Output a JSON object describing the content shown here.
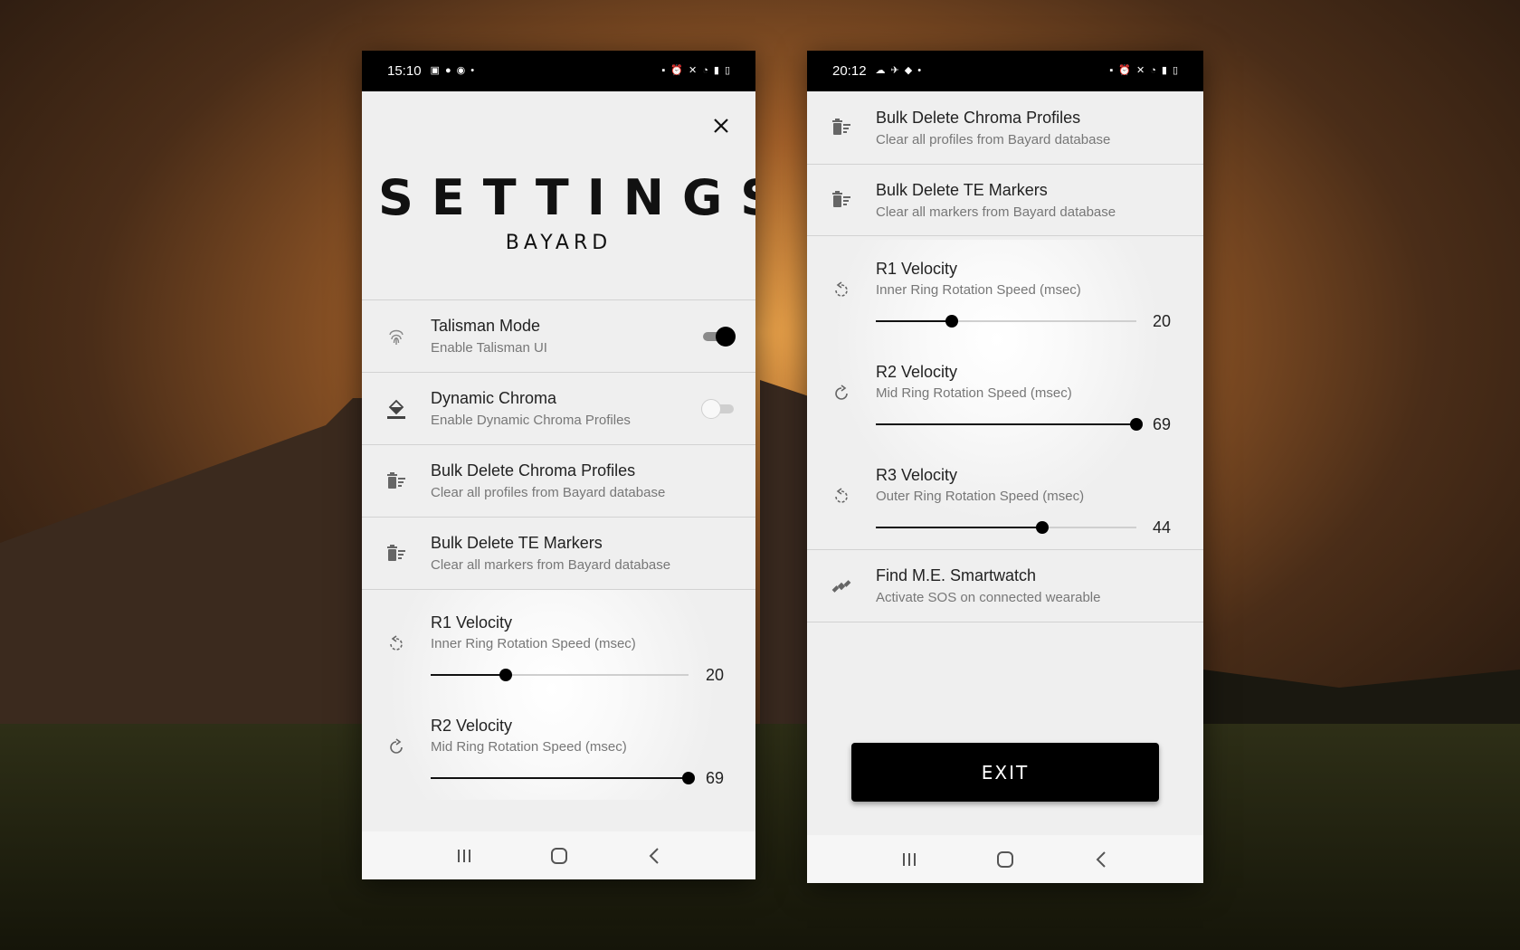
{
  "left_phone": {
    "status": {
      "time": "15:10"
    },
    "title": "SETTINGS",
    "subtitle": "BAYARD",
    "rows": [
      {
        "icon": "fingerprint-icon",
        "title": "Talisman Mode",
        "subtitle": "Enable Talisman UI",
        "toggle": true
      },
      {
        "icon": "paint-bucket-icon",
        "title": "Dynamic Chroma",
        "subtitle": "Enable Dynamic Chroma Profiles",
        "toggle": false
      },
      {
        "icon": "delete-sweep-icon",
        "title": "Bulk Delete Chroma Profiles",
        "subtitle": "Clear all profiles from Bayard database"
      },
      {
        "icon": "delete-sweep-icon",
        "title": "Bulk Delete TE Markers",
        "subtitle": "Clear all markers from Bayard database"
      }
    ],
    "sliders": [
      {
        "icon": "rotate-ccw-icon",
        "title": "R1 Velocity",
        "subtitle": "Inner Ring Rotation Speed (msec)",
        "value": "20",
        "fraction": 0.29
      },
      {
        "icon": "rotate-cw-icon",
        "title": "R2 Velocity",
        "subtitle": "Mid Ring Rotation Speed (msec)",
        "value": "69",
        "fraction": 1.0
      }
    ]
  },
  "right_phone": {
    "status": {
      "time": "20:12"
    },
    "rows": [
      {
        "icon": "delete-sweep-icon",
        "title": "Bulk Delete Chroma Profiles",
        "subtitle": "Clear all profiles from Bayard database"
      },
      {
        "icon": "delete-sweep-icon",
        "title": "Bulk Delete TE Markers",
        "subtitle": "Clear all markers from Bayard database"
      }
    ],
    "sliders": [
      {
        "icon": "rotate-ccw-icon",
        "title": "R1 Velocity",
        "subtitle": "Inner Ring Rotation Speed (msec)",
        "value": "20",
        "fraction": 0.29
      },
      {
        "icon": "rotate-cw-icon",
        "title": "R2 Velocity",
        "subtitle": "Mid Ring Rotation Speed (msec)",
        "value": "69",
        "fraction": 1.0
      },
      {
        "icon": "rotate-ccw-icon",
        "title": "R3 Velocity",
        "subtitle": "Outer Ring Rotation Speed (msec)",
        "value": "44",
        "fraction": 0.64
      }
    ],
    "find_row": {
      "icon": "satellite-icon",
      "title": "Find M.E. Smartwatch",
      "subtitle": "Activate SOS on connected wearable"
    },
    "exit_label": "EXIT"
  },
  "colors": {
    "accent": "#000000",
    "panel": "#efefef",
    "divider": "#d2d2d2",
    "subtext": "#777777"
  }
}
